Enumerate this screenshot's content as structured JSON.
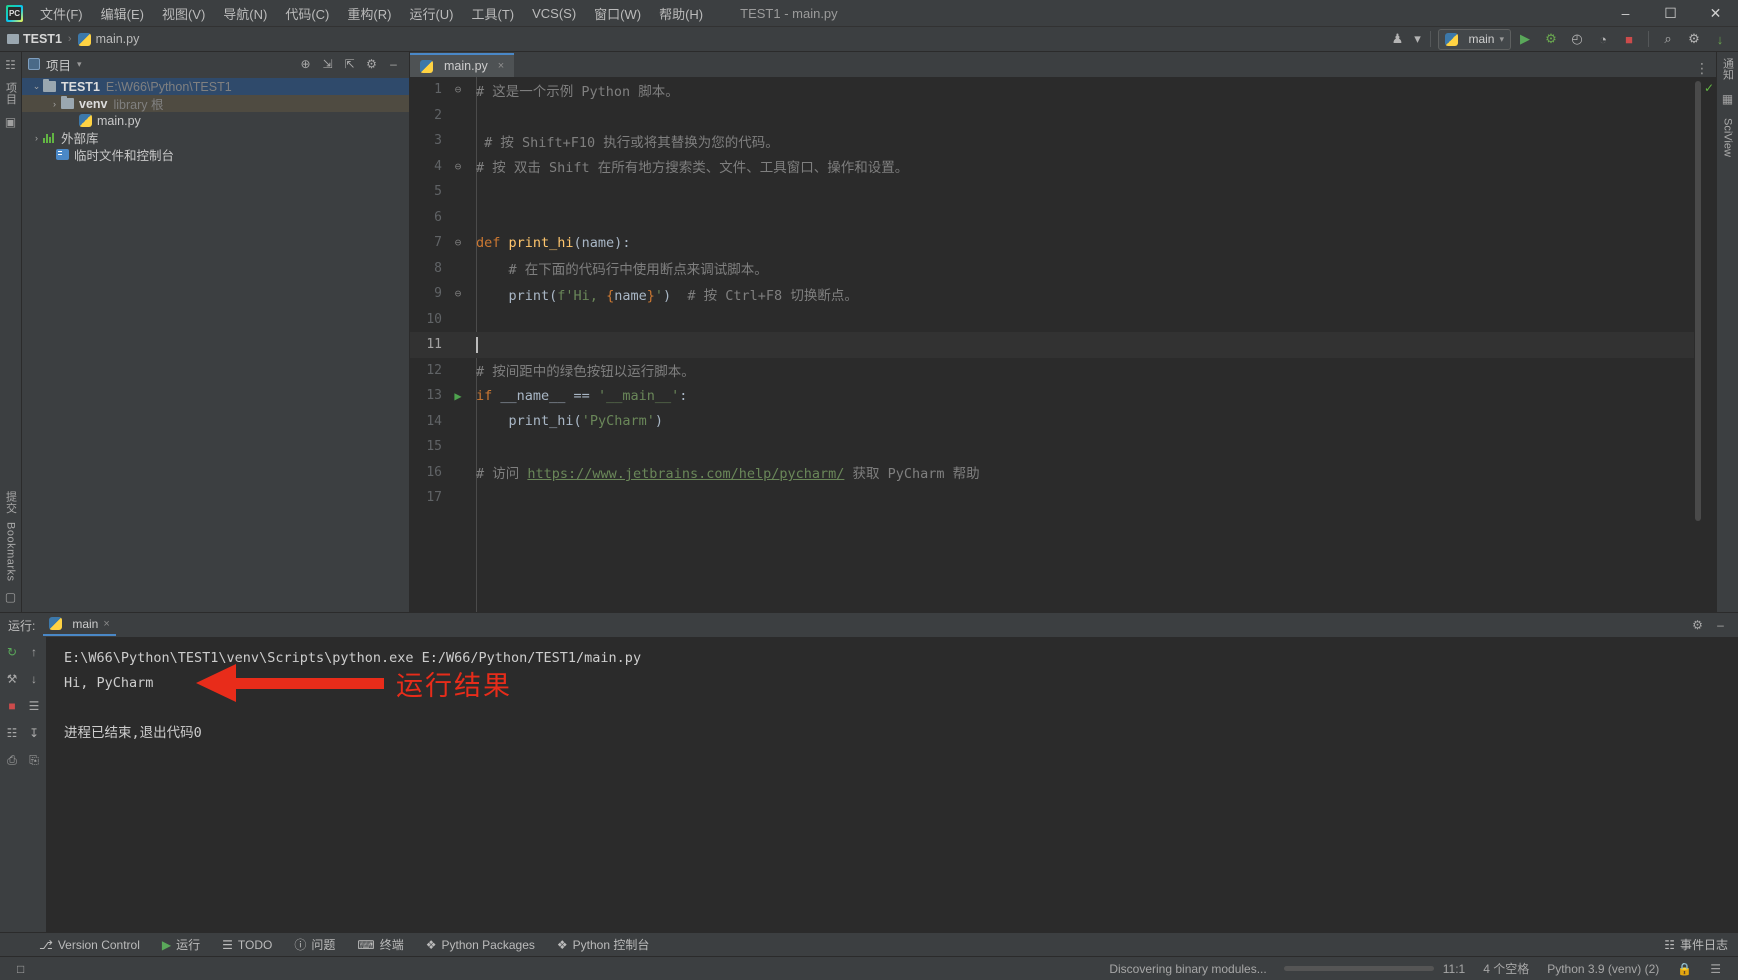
{
  "window": {
    "title": "TEST1 - main.py",
    "logo": "pycharm-logo",
    "minimize": "–",
    "maximize": "☐",
    "close": "✕"
  },
  "menu": [
    {
      "label": "文件(F)"
    },
    {
      "label": "编辑(E)"
    },
    {
      "label": "视图(V)"
    },
    {
      "label": "导航(N)"
    },
    {
      "label": "代码(C)"
    },
    {
      "label": "重构(R)"
    },
    {
      "label": "运行(U)"
    },
    {
      "label": "工具(T)"
    },
    {
      "label": "VCS(S)"
    },
    {
      "label": "窗口(W)"
    },
    {
      "label": "帮助(H)"
    }
  ],
  "navbar": {
    "crumb_project": "TEST1",
    "crumb_sep": "›",
    "crumb_file": "main.py",
    "run_config": "main",
    "run_config_caret": "▾",
    "user_caret": "▾",
    "icons": {
      "user": "♟",
      "run": "▶",
      "debug": "⚙",
      "coverage": "◴",
      "profile": "◔",
      "stop": "■",
      "search": "⌕",
      "settings": "⚙",
      "updates": "↓"
    }
  },
  "left_rail": {
    "project_label": "项目",
    "structure_icon": "☷",
    "folder_icon": "▣",
    "bookmarks_label": "Bookmarks",
    "commit_label": "提交"
  },
  "project_panel": {
    "title": "项目",
    "caret": "▾",
    "actions": [
      "target-icon",
      "collapse-icon",
      "expand-icon",
      "gear-icon",
      "hide-icon"
    ],
    "action_glyphs": [
      "⊕",
      "⇲",
      "⇱",
      "⚙",
      "–"
    ],
    "tree": [
      {
        "indent": 0,
        "arrow": "⌄",
        "icon": "folder",
        "label": "TEST1",
        "sub": "E:\\W66\\Python\\TEST1",
        "bold": true,
        "selected": "primary"
      },
      {
        "indent": 1,
        "arrow": "›",
        "icon": "folder",
        "label": "venv",
        "sub": "library 根",
        "bold": true,
        "selected": "secondary"
      },
      {
        "indent": 2,
        "arrow": "",
        "icon": "python",
        "label": "main.py",
        "sub": "",
        "bold": false,
        "selected": "none"
      },
      {
        "indent": 0,
        "arrow": "›",
        "icon": "library",
        "label": "外部库",
        "sub": "",
        "bold": false,
        "selected": "none"
      },
      {
        "indent": 0,
        "arrow": "",
        "icon": "scratch",
        "label": "临时文件和控制台",
        "sub": "",
        "bold": false,
        "selected": "none"
      }
    ]
  },
  "editor": {
    "tab": {
      "label": "main.py",
      "close": "×"
    },
    "tabs_right_glyph": "⋮",
    "inspection_ok": "✓",
    "lines": [
      {
        "n": "1",
        "fold": "⊖",
        "mark": "",
        "tokens": [
          {
            "t": "# 这是一个示例 Python 脚本。",
            "c": "cmt"
          }
        ]
      },
      {
        "n": "2",
        "fold": "",
        "mark": "",
        "tokens": []
      },
      {
        "n": "3",
        "fold": "",
        "mark": "",
        "tokens": [
          {
            "t": " # 按 Shift+F10 执行或将其替换为您的代码。",
            "c": "cmt"
          }
        ]
      },
      {
        "n": "4",
        "fold": "⊖",
        "mark": "",
        "tokens": [
          {
            "t": "# 按 双击 Shift 在所有地方搜索类、文件、工具窗口、操作和设置。",
            "c": "cmt"
          }
        ]
      },
      {
        "n": "5",
        "fold": "",
        "mark": "",
        "tokens": []
      },
      {
        "n": "6",
        "fold": "",
        "mark": "",
        "tokens": []
      },
      {
        "n": "7",
        "fold": "⊖",
        "mark": "",
        "tokens": [
          {
            "t": "def ",
            "c": "kw"
          },
          {
            "t": "print_hi",
            "c": "fn"
          },
          {
            "t": "(name):",
            "c": "def"
          }
        ]
      },
      {
        "n": "8",
        "fold": "",
        "mark": "",
        "tokens": [
          {
            "t": "    # 在下面的代码行中使用断点来调试脚本。",
            "c": "cmt"
          }
        ]
      },
      {
        "n": "9",
        "fold": "⊖",
        "mark": "",
        "tokens": [
          {
            "t": "    ",
            "c": "def"
          },
          {
            "t": "print",
            "c": "fn2"
          },
          {
            "t": "(",
            "c": "def"
          },
          {
            "t": "f'Hi, ",
            "c": "str"
          },
          {
            "t": "{",
            "c": "fstr-br"
          },
          {
            "t": "name",
            "c": "def"
          },
          {
            "t": "}",
            "c": "fstr-br"
          },
          {
            "t": "'",
            "c": "str"
          },
          {
            "t": ")",
            "c": "def"
          },
          {
            "t": "  # 按 Ctrl+F8 切换断点。",
            "c": "cmt"
          }
        ]
      },
      {
        "n": "10",
        "fold": "",
        "mark": "",
        "tokens": []
      },
      {
        "n": "11",
        "fold": "",
        "mark": "",
        "current": true,
        "caret": true,
        "tokens": []
      },
      {
        "n": "12",
        "fold": "",
        "mark": "",
        "tokens": [
          {
            "t": "# 按间距中的绿色按钮以运行脚本。",
            "c": "cmt"
          }
        ]
      },
      {
        "n": "13",
        "fold": "",
        "mark": "▶",
        "tokens": [
          {
            "t": "if ",
            "c": "kw"
          },
          {
            "t": "__name__ ",
            "c": "def"
          },
          {
            "t": "== ",
            "c": "def"
          },
          {
            "t": "'__main__'",
            "c": "str"
          },
          {
            "t": ":",
            "c": "def"
          }
        ]
      },
      {
        "n": "14",
        "fold": "",
        "mark": "",
        "tokens": [
          {
            "t": "    ",
            "c": "def"
          },
          {
            "t": "print_hi",
            "c": "def"
          },
          {
            "t": "(",
            "c": "def"
          },
          {
            "t": "'PyCharm'",
            "c": "str"
          },
          {
            "t": ")",
            "c": "def"
          }
        ]
      },
      {
        "n": "15",
        "fold": "",
        "mark": "",
        "tokens": []
      },
      {
        "n": "16",
        "fold": "",
        "mark": "",
        "tokens": [
          {
            "t": "# 访问 ",
            "c": "cmt"
          },
          {
            "t": "https://www.jetbrains.com/help/pycharm/",
            "c": "link"
          },
          {
            "t": " 获取 PyCharm 帮助",
            "c": "cmt"
          }
        ]
      },
      {
        "n": "17",
        "fold": "",
        "mark": "",
        "tokens": []
      }
    ]
  },
  "run_window": {
    "label": "运行:",
    "tab_label": "main",
    "tab_close": "×",
    "settings_glyph": "⚙",
    "hide_glyph": "–",
    "sidebar_glyphs": [
      "↻",
      "↑",
      "↓",
      "⚒",
      "☰",
      "■",
      "☰",
      "☷",
      "↧",
      "⎙",
      "⎘",
      "✕"
    ],
    "console": {
      "command": "E:\\W66\\Python\\TEST1\\venv\\Scripts\\python.exe E:/W66/Python/TEST1/main.py",
      "output": "Hi, PyCharm",
      "exit": "进程已结束,退出代码0"
    },
    "annotation": {
      "text": "运行结果",
      "color": "#e82c1a"
    }
  },
  "bottom_toolbar": {
    "items": [
      {
        "icon": "⎇",
        "label": "Version Control"
      },
      {
        "icon": "▶",
        "label": "运行"
      },
      {
        "icon": "☰",
        "label": "TODO"
      },
      {
        "icon": "ⓘ",
        "label": "问题"
      },
      {
        "icon": "⌨",
        "label": "终端"
      },
      {
        "icon": "❖",
        "label": "Python Packages"
      },
      {
        "icon": "❖",
        "label": "Python 控制台"
      }
    ],
    "right": {
      "icon": "☷",
      "label": "事件日志"
    }
  },
  "statusbar": {
    "left_icon": "□",
    "progress_text": "Discovering binary modules...",
    "progress_percent": 62,
    "position": "11:1",
    "indent": "4 个空格",
    "interpreter": "Python 3.9 (venv) (2)",
    "lock_icon": "ὑ2",
    "notify_icon": "☰"
  }
}
